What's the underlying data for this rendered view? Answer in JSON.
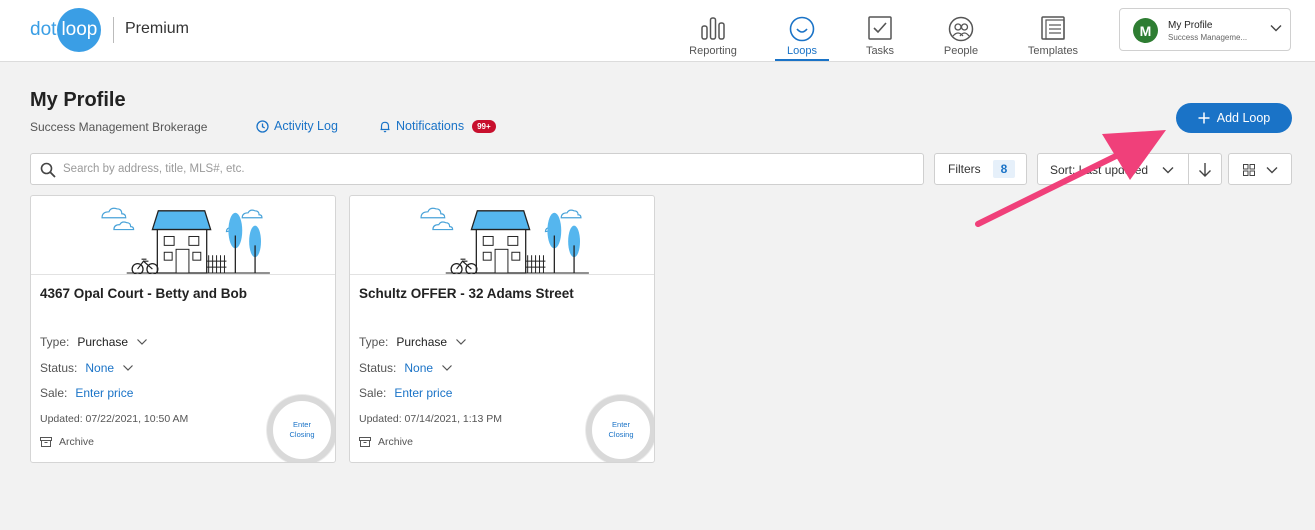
{
  "brand": {
    "dot": "dot",
    "loop": "loop",
    "edition": "Premium"
  },
  "nav": [
    {
      "label": "Reporting",
      "icon": "bar-chart-icon"
    },
    {
      "label": "Loops",
      "icon": "loop-icon",
      "active": true
    },
    {
      "label": "Tasks",
      "icon": "checkbox-icon"
    },
    {
      "label": "People",
      "icon": "people-icon"
    },
    {
      "label": "Templates",
      "icon": "templates-icon"
    }
  ],
  "profile": {
    "initial": "M",
    "name": "My Profile",
    "subtitle": "Success Manageme..."
  },
  "header": {
    "title": "My Profile",
    "subtitle": "Success Management Brokerage",
    "activity_log": "Activity Log",
    "notifications": "Notifications",
    "notifications_badge": "99+",
    "add_loop": "Add Loop"
  },
  "toolbar": {
    "search_placeholder": "Search by address, title, MLS#, etc.",
    "filters_label": "Filters",
    "filters_count": "8",
    "sort_label": "Sort: Last updated"
  },
  "labels": {
    "type": "Type:",
    "status": "Status:",
    "sale": "Sale:",
    "archive": "Archive",
    "enter": "Enter",
    "closing": "Closing"
  },
  "cards": [
    {
      "title": "4367 Opal Court - Betty and Bob",
      "type": "Purchase",
      "status": "None",
      "sale": "Enter price",
      "updated": "Updated: 07/22/2021, 10:50 AM"
    },
    {
      "title": "Schultz OFFER - 32 Adams Street",
      "type": "Purchase",
      "status": "None",
      "sale": "Enter price",
      "updated": "Updated: 07/14/2021, 1:13 PM"
    }
  ],
  "colors": {
    "accent": "#1a73c7",
    "brand": "#3a9ee5",
    "badge": "#c8102e",
    "arrow": "#f0407a",
    "avatar": "#2e7d32"
  }
}
